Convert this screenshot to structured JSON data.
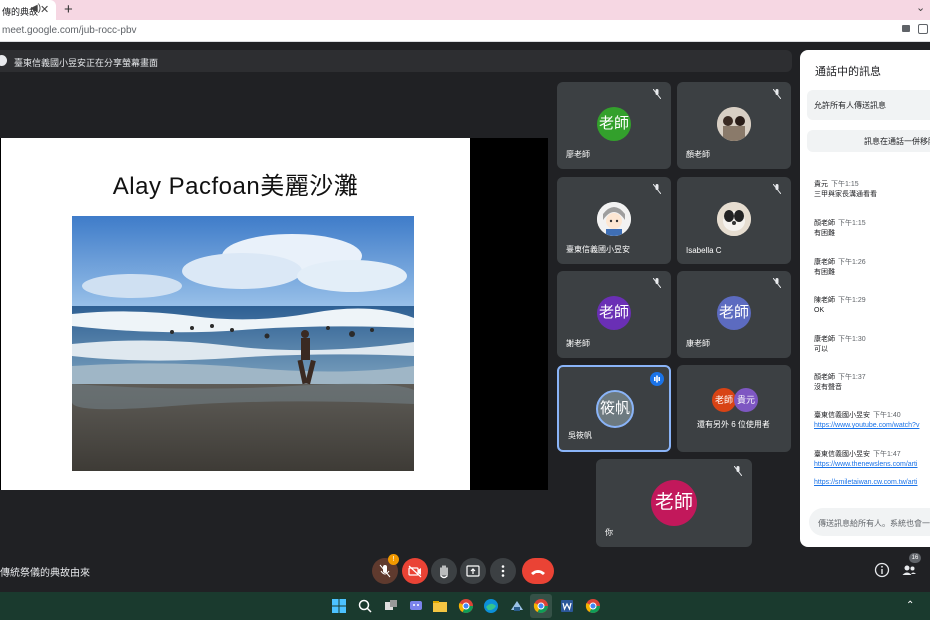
{
  "browser": {
    "tab_title": "傳的典故",
    "url": "meet.google.com/jub-rocc-pbv"
  },
  "presenter_banner": "臺東信義國小昱安正在分享螢幕畫面",
  "slide": {
    "title": "Alay Pacfoan美麗沙灘"
  },
  "tiles": [
    {
      "name": "廖老師",
      "avatar_text": "老師",
      "avatar_color": "#33a02c",
      "muted": true
    },
    {
      "name": "顏老師",
      "avatar_text": "",
      "muted": true
    },
    {
      "name": "臺東信義國小昱安",
      "avatar_text": "",
      "muted": true
    },
    {
      "name": "Isabella C",
      "avatar_text": "",
      "muted": true
    },
    {
      "name": "謝老師",
      "avatar_text": "老師",
      "avatar_color": "#6a2fb5",
      "muted": true
    },
    {
      "name": "康老師",
      "avatar_text": "老師",
      "avatar_color": "#5c6bc0",
      "muted": true
    },
    {
      "name": "吳筱帆",
      "avatar_text": "筱帆",
      "avatar_color": "#6d7a80",
      "muted": false
    },
    {
      "name": "還有另外 6 位使用者",
      "avatar_text": "老師",
      "avatar_text_2": "貴元",
      "avatar_color": "#d84315",
      "avatar_color_2": "#7e57c2"
    },
    {
      "name": "你",
      "avatar_text": "老師",
      "avatar_color": "#c2185b",
      "muted": true
    }
  ],
  "chat": {
    "title": "通話中的訊息",
    "allow_everyone": "允許所有人傳送訊息",
    "keep_messages": "訊息在通話一併移除",
    "messages": [
      {
        "sender": "貴元",
        "time": "下午1:15",
        "text": "三甲與家長溝通看看"
      },
      {
        "sender": "顏老師",
        "time": "下午1:15",
        "text": "有困難"
      },
      {
        "sender": "康老師",
        "time": "下午1:26",
        "text": "有困難"
      },
      {
        "sender": "陳老師",
        "time": "下午1:29",
        "text": "OK"
      },
      {
        "sender": "康老師",
        "time": "下午1:30",
        "text": "可以"
      },
      {
        "sender": "顏老師",
        "time": "下午1:37",
        "text": "沒有聲音"
      },
      {
        "sender": "臺東信義國小昱安",
        "time": "下午1:40",
        "link": "https://www.youtube.com/watch?v"
      },
      {
        "sender": "臺東信義國小昱安",
        "time": "下午1:47",
        "link": "https://www.thenewslens.com/arti"
      },
      {
        "link": "https://smiletaiwan.cw.com.tw/arti"
      }
    ],
    "input_placeholder": "傳送訊息給所有人。系統也會一併"
  },
  "bottom": {
    "meeting_name": "傳統祭儀的典故由來",
    "mic_badge": "!",
    "people_count": "16"
  },
  "colors": {
    "meet_bg": "#202124",
    "tile_bg": "#3c4043",
    "end_call": "#ea4335",
    "taskbar": "#1a3a2e"
  }
}
